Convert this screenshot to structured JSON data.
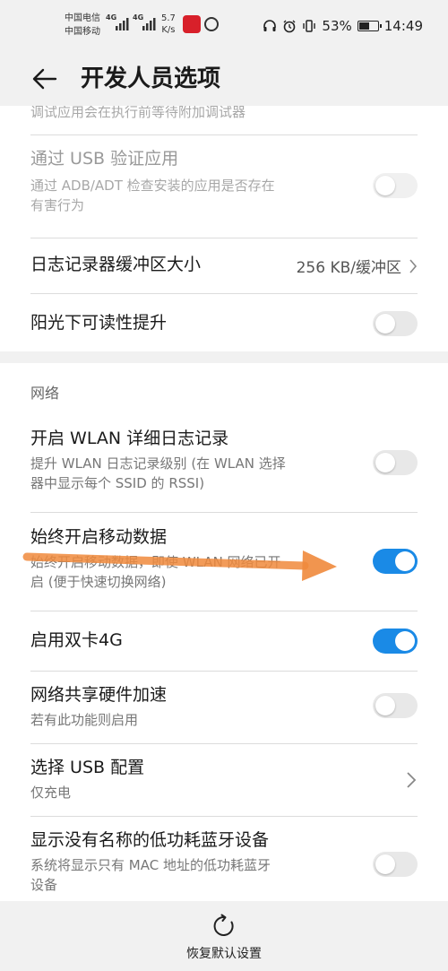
{
  "status_bar": {
    "carrier_1": "中国电信",
    "carrier_2": "中国移动",
    "net_1": "4G",
    "net_2": "4G",
    "speed_value": "5.7",
    "speed_unit": "K/s",
    "battery_percent": "53%",
    "battery_level": 0.53,
    "time": "14:49"
  },
  "header": {
    "title": "开发人员选项"
  },
  "settings": {
    "debug_wait_partial": "调试应用会在执行前等待附加调试器",
    "verify_usb_title": "通过 USB 验证应用",
    "verify_usb_desc_1": "通过 ADB/ADT 检查安装的应用是否存在",
    "verify_usb_desc_2": "有害行为",
    "logger_buffer_title": "日志记录器缓冲区大小",
    "logger_buffer_value": "256 KB/缓冲区",
    "sunlight_title": "阳光下可读性提升"
  },
  "network": {
    "section_label": "网络",
    "wlan_log_title": "开启 WLAN 详细日志记录",
    "wlan_log_desc_1": "提升 WLAN 日志记录级别 (在 WLAN 选择",
    "wlan_log_desc_2": "器中显示每个 SSID 的 RSSI)",
    "mobile_data_title": "始终开启移动数据",
    "mobile_data_desc_1": "始终开启移动数据，即使 WLAN 网络已开",
    "mobile_data_desc_2": "启 (便于快速切换网络)",
    "dual_4g_title": "启用双卡4G",
    "tether_hw_title": "网络共享硬件加速",
    "tether_hw_desc": "若有此功能则启用",
    "usb_config_title": "选择 USB 配置",
    "usb_config_desc": "仅充电",
    "ble_noname_title": "显示没有名称的低功耗蓝牙设备",
    "ble_noname_desc_1": "系统将显示只有 MAC 地址的低功耗蓝牙",
    "ble_noname_desc_2": "设备"
  },
  "footer": {
    "reset_label": "恢复默认设置"
  },
  "colors": {
    "accent": "#1a8ae6",
    "annotation_arrow": "#f08a3c"
  }
}
